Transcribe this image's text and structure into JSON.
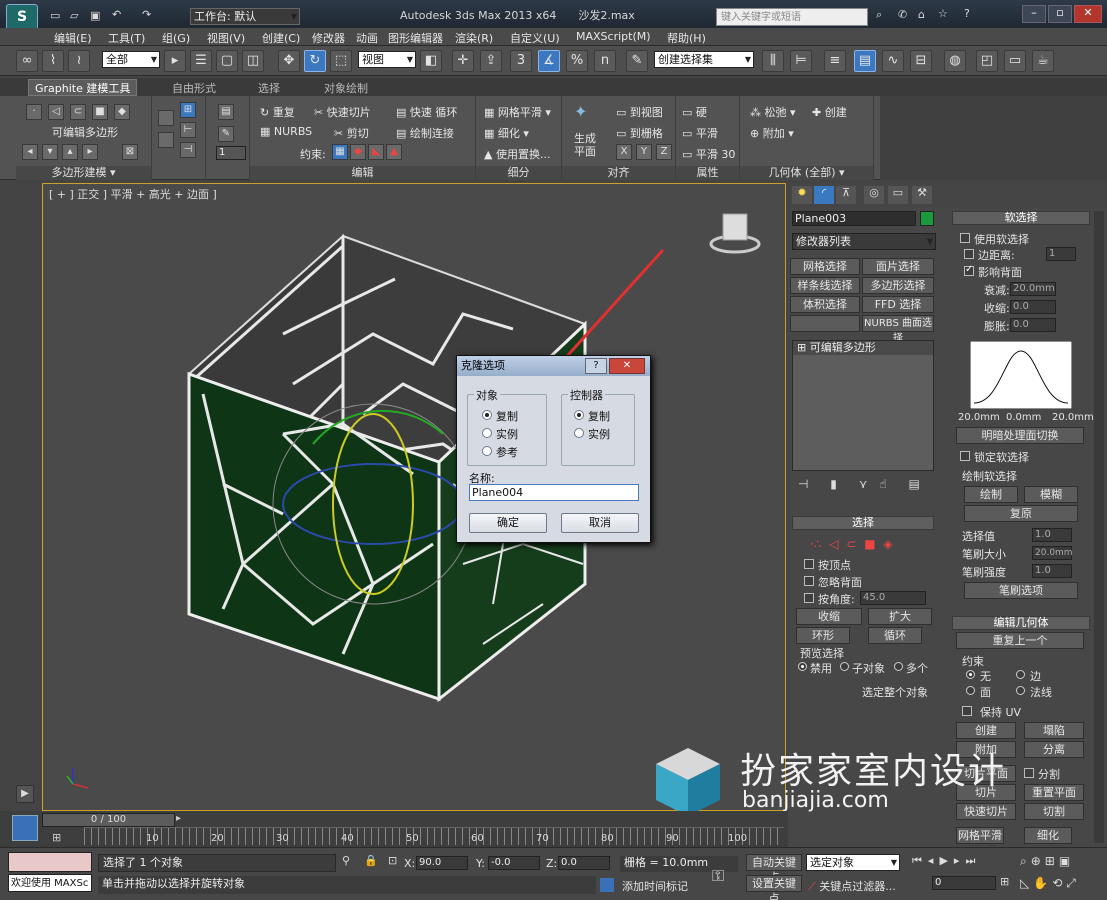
{
  "titlebar": {
    "workspace_label": "工作台: 默认",
    "app_title": "Autodesk 3ds Max  2013 x64",
    "file_name": "沙发2.max",
    "search_placeholder": "键入关键字或短语"
  },
  "menu": [
    "编辑(E)",
    "工具(T)",
    "组(G)",
    "视图(V)",
    "创建(C)",
    "修改器",
    "动画",
    "图形编辑器",
    "渲染(R)",
    "自定义(U)",
    "MAXScript(M)",
    "帮助(H)"
  ],
  "toolbar": {
    "selection_filter": "全部",
    "ref_coord": "视图",
    "named_selection": "创建选择集",
    "snap_num": "3",
    "snap_pct": "%",
    "snap_n": "n"
  },
  "ribbon_tabs": [
    "Graphite 建模工具",
    "自由形式",
    "选择",
    "对象绘制"
  ],
  "ribbon": {
    "poly_mode_label": "可编辑多边形",
    "poly_section": "多边形建模 ▾",
    "edit_section": "编辑",
    "edit_items": [
      "重复",
      "快速切片",
      "快速 循环",
      "NURBS",
      "剪切",
      "绘制连接",
      "约束:"
    ],
    "subdiv_section": "细分",
    "subdiv_items": [
      "网格平滑",
      "细化",
      "使用置换..."
    ],
    "align_section": "对齐",
    "align_big": "生成\n平面",
    "align_items": [
      "到视图",
      "到栅格",
      "X",
      "Y",
      "Z"
    ],
    "props_section": "属性",
    "props_items": [
      "硬",
      "平滑",
      "平滑 30"
    ],
    "geom_section": "几何体 (全部) ▾",
    "geom_items": [
      "松弛",
      "创建",
      "附加"
    ],
    "spinner_val": "1"
  },
  "viewport": {
    "label": "[ + ] 正交 ] 平滑 + 高光 + 边面 ]"
  },
  "dialog": {
    "title": "克隆选项",
    "help": "?",
    "close": "✕",
    "object_group": "对象",
    "object_opts": [
      "复制",
      "实例",
      "参考"
    ],
    "object_selected": 0,
    "controller_group": "控制器",
    "controller_opts": [
      "复制",
      "实例"
    ],
    "controller_selected": 0,
    "name_label": "名称:",
    "name_value": "Plane004",
    "ok": "确定",
    "cancel": "取消"
  },
  "cmdpanel": {
    "object_name": "Plane003",
    "object_color": "#1a9a3a",
    "modifier_list": "修改器列表",
    "mod_buttons": [
      "网格选择",
      "面片选择",
      "样条线选择",
      "多边形选择",
      "体积选择",
      "FFD 选择",
      "",
      "NURBS 曲面选择"
    ],
    "stack_item": "可编辑多边形",
    "select_header": "选择",
    "by_vertex": "按顶点",
    "ignore_back": "忽略背面",
    "by_angle": "按角度:",
    "angle_val": "45.0",
    "shrink": "收缩",
    "grow": "扩大",
    "ring": "环形",
    "loop": "循环",
    "preview_label": "预览选择",
    "preview_opts": [
      "禁用",
      "子对象",
      "多个"
    ],
    "whole_object": "选定整个对象"
  },
  "rollouts": {
    "soft_header": "软选择",
    "use_soft": "使用软选择",
    "edge_dist": "边距离:",
    "edge_dist_val": "1",
    "affect_back": "影响背面",
    "falloff": "衰减:",
    "falloff_val": "20.0mm",
    "pinch": "收缩:",
    "pinch_val": "0.0",
    "bubble": "膨胀:",
    "bubble_val": "0.0",
    "curve_left": "20.0mm",
    "curve_mid": "0.0mm",
    "curve_right": "20.0mm",
    "shade_face": "明暗处理面切换",
    "lock_soft": "锁定软选择",
    "paint_group": "绘制软选择",
    "paint": "绘制",
    "blur": "模糊",
    "revert": "复原",
    "sel_value": "选择值",
    "sel_value_val": "1.0",
    "brush_size": "笔刷大小",
    "brush_size_val": "20.0mm",
    "brush_strength": "笔刷强度",
    "brush_strength_val": "1.0",
    "brush_opts": "笔刷选项",
    "edit_geom_header": "编辑几何体",
    "repeat_last": "重复上一个",
    "constraint": "约束",
    "c_none": "无",
    "c_edge": "边",
    "c_face": "面",
    "c_normal": "法线",
    "keep_uv": "保持 UV",
    "create": "创建",
    "collapse": "塌陷",
    "attach": "附加",
    "detach": "分离",
    "slice_plane": "切片平面",
    "split": "分割",
    "slice": "切片",
    "reset_plane": "重置平面",
    "quick_slice": "快速切片",
    "cut": "切割",
    "meshsmooth": "网格平滑",
    "tessellate": "细化"
  },
  "timeline": {
    "range": "0 / 100",
    "ticks": [
      "10",
      "20",
      "30",
      "40",
      "50",
      "60",
      "70",
      "80",
      "90",
      "100"
    ]
  },
  "status": {
    "welcome": "欢迎使用 MAXSc",
    "selected": "选择了 1 个对象",
    "hint": "单击并拖动以选择并旋转对象",
    "x": "90.0",
    "y": "-0.0",
    "z": "0.0",
    "grid": "栅格 = 10.0mm",
    "add_time_tag": "添加时间标记",
    "auto_key": "自动关键点",
    "set_key": "设置关键点",
    "selected_obj": "选定对象",
    "key_filters": "关键点过滤器...",
    "frame": "0"
  },
  "watermark": {
    "brand_cn": "扮家家室内设计",
    "brand_url": "banjiajia.com"
  }
}
